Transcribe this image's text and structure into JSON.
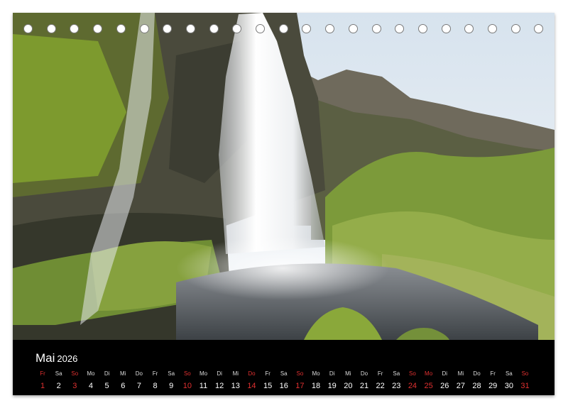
{
  "calendar": {
    "month": "Mai",
    "year": "2026",
    "holes": 23,
    "accent_color": "#e03030",
    "days": [
      {
        "wd": "Fr",
        "d": "1",
        "red": true
      },
      {
        "wd": "Sa",
        "d": "2",
        "red": false
      },
      {
        "wd": "So",
        "d": "3",
        "red": true
      },
      {
        "wd": "Mo",
        "d": "4",
        "red": false
      },
      {
        "wd": "Di",
        "d": "5",
        "red": false
      },
      {
        "wd": "Mi",
        "d": "6",
        "red": false
      },
      {
        "wd": "Do",
        "d": "7",
        "red": false
      },
      {
        "wd": "Fr",
        "d": "8",
        "red": false
      },
      {
        "wd": "Sa",
        "d": "9",
        "red": false
      },
      {
        "wd": "So",
        "d": "10",
        "red": true
      },
      {
        "wd": "Mo",
        "d": "11",
        "red": false
      },
      {
        "wd": "Di",
        "d": "12",
        "red": false
      },
      {
        "wd": "Mi",
        "d": "13",
        "red": false
      },
      {
        "wd": "Do",
        "d": "14",
        "red": true
      },
      {
        "wd": "Fr",
        "d": "15",
        "red": false
      },
      {
        "wd": "Sa",
        "d": "16",
        "red": false
      },
      {
        "wd": "So",
        "d": "17",
        "red": true
      },
      {
        "wd": "Mo",
        "d": "18",
        "red": false
      },
      {
        "wd": "Di",
        "d": "19",
        "red": false
      },
      {
        "wd": "Mi",
        "d": "20",
        "red": false
      },
      {
        "wd": "Do",
        "d": "21",
        "red": false
      },
      {
        "wd": "Fr",
        "d": "22",
        "red": false
      },
      {
        "wd": "Sa",
        "d": "23",
        "red": false
      },
      {
        "wd": "So",
        "d": "24",
        "red": true
      },
      {
        "wd": "Mo",
        "d": "25",
        "red": true
      },
      {
        "wd": "Di",
        "d": "26",
        "red": false
      },
      {
        "wd": "Mi",
        "d": "27",
        "red": false
      },
      {
        "wd": "Do",
        "d": "28",
        "red": false
      },
      {
        "wd": "Fr",
        "d": "29",
        "red": false
      },
      {
        "wd": "Sa",
        "d": "30",
        "red": false
      },
      {
        "wd": "So",
        "d": "31",
        "red": true
      }
    ]
  }
}
